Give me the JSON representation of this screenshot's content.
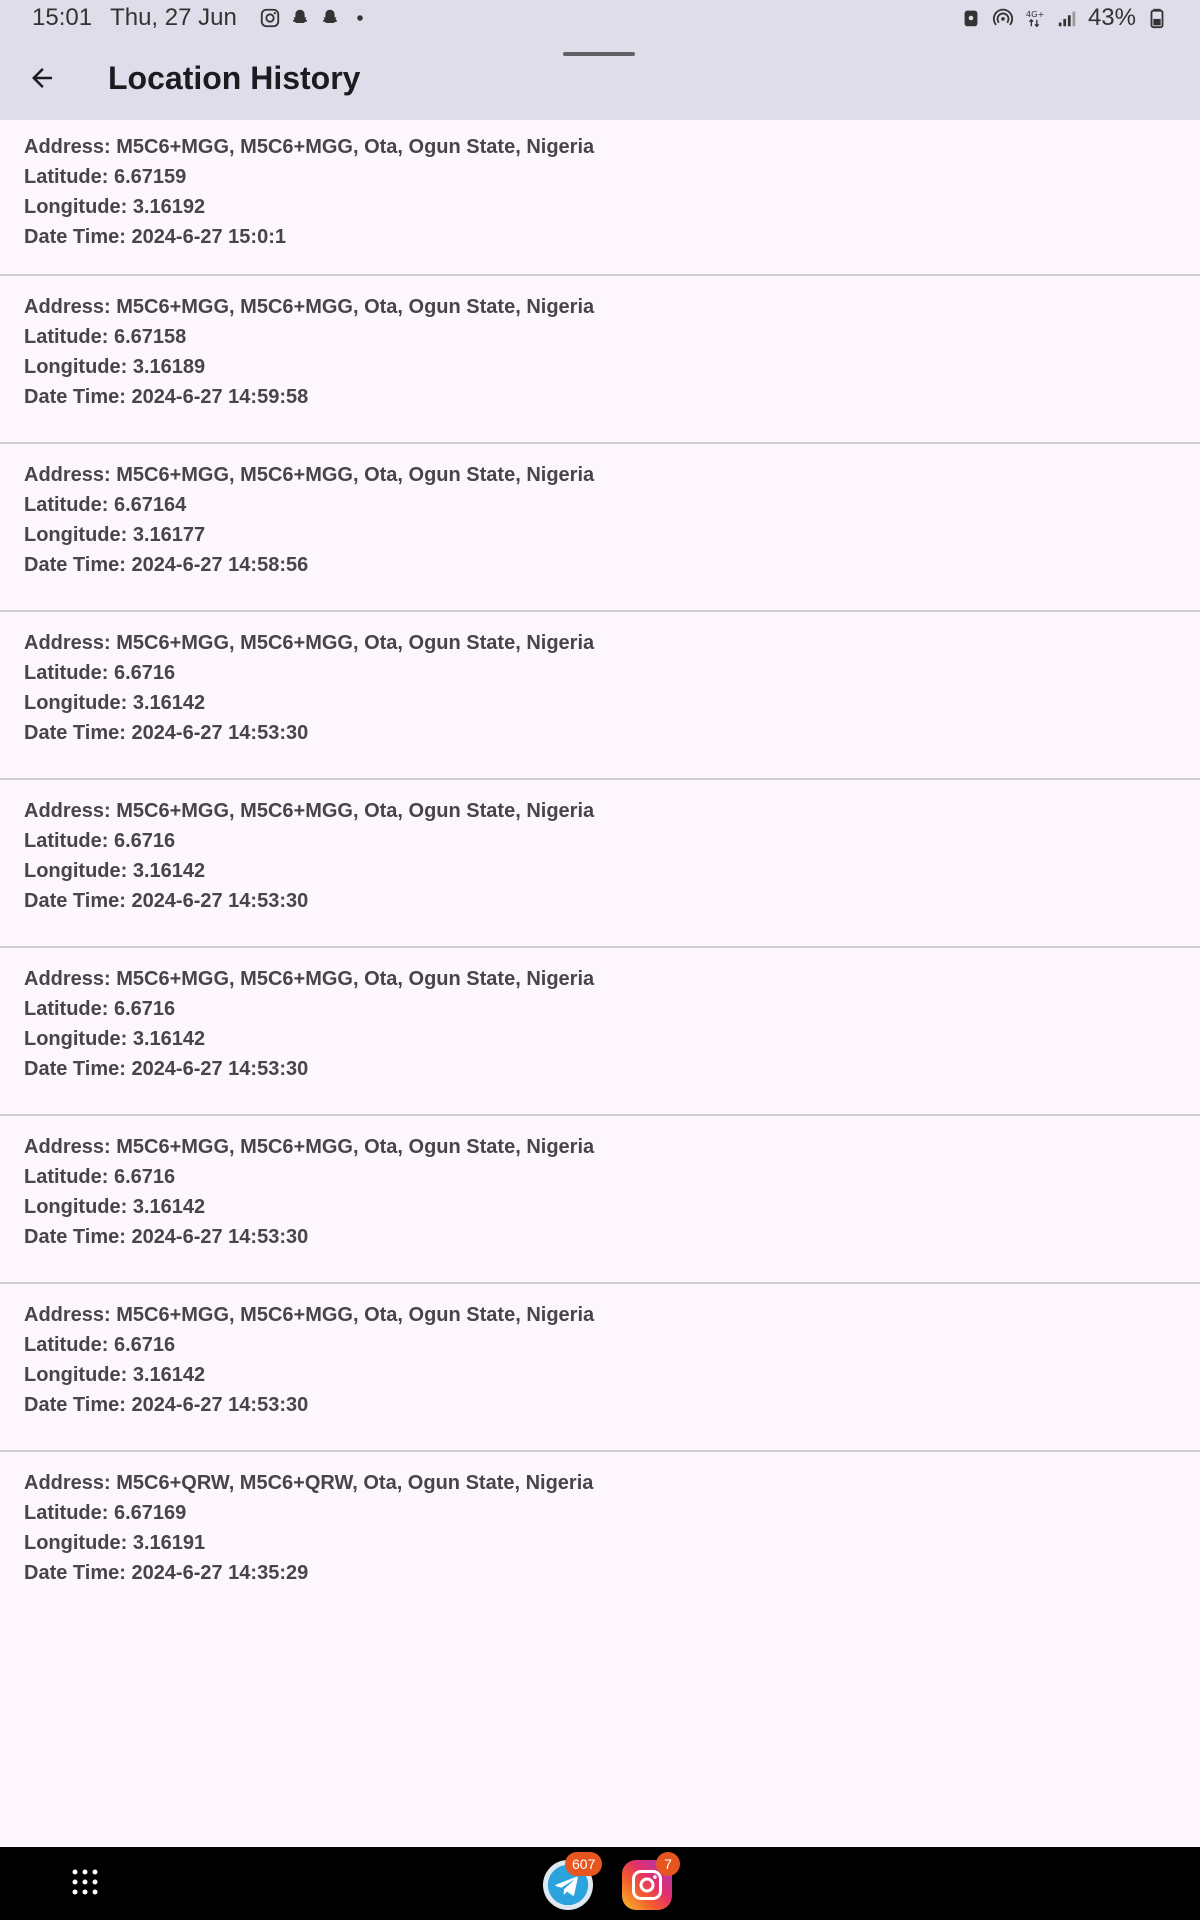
{
  "status_bar": {
    "time": "15:01",
    "date": "Thu, 27 Jun",
    "icons": [
      "instagram-icon",
      "snapchat-icon",
      "snapchat-icon",
      "dot-icon"
    ],
    "battery": "43%",
    "right_icons": [
      "lock-icon",
      "hotspot-icon",
      "network-4g-icon",
      "signal-icon",
      "battery-icon"
    ]
  },
  "app_bar": {
    "title": "Location History",
    "back_icon": "arrow-back-icon"
  },
  "items": [
    {
      "address": "Address: M5C6+MGG, M5C6+MGG, Ota, Ogun State, Nigeria",
      "latitude": "Latitude: 6.67159",
      "longitude": "Longitude: 3.16192",
      "datetime": "Date Time: 2024-6-27 15:0:1"
    },
    {
      "address": "Address: M5C6+MGG, M5C6+MGG, Ota, Ogun State, Nigeria",
      "latitude": "Latitude: 6.67158",
      "longitude": "Longitude: 3.16189",
      "datetime": "Date Time: 2024-6-27 14:59:58"
    },
    {
      "address": "Address: M5C6+MGG, M5C6+MGG, Ota, Ogun State, Nigeria",
      "latitude": "Latitude: 6.67164",
      "longitude": "Longitude: 3.16177",
      "datetime": "Date Time: 2024-6-27 14:58:56"
    },
    {
      "address": "Address: M5C6+MGG, M5C6+MGG, Ota, Ogun State, Nigeria",
      "latitude": "Latitude: 6.6716",
      "longitude": "Longitude: 3.16142",
      "datetime": "Date Time: 2024-6-27 14:53:30"
    },
    {
      "address": "Address: M5C6+MGG, M5C6+MGG, Ota, Ogun State, Nigeria",
      "latitude": "Latitude: 6.6716",
      "longitude": "Longitude: 3.16142",
      "datetime": "Date Time: 2024-6-27 14:53:30"
    },
    {
      "address": "Address: M5C6+MGG, M5C6+MGG, Ota, Ogun State, Nigeria",
      "latitude": "Latitude: 6.6716",
      "longitude": "Longitude: 3.16142",
      "datetime": "Date Time: 2024-6-27 14:53:30"
    },
    {
      "address": "Address: M5C6+MGG, M5C6+MGG, Ota, Ogun State, Nigeria",
      "latitude": "Latitude: 6.6716",
      "longitude": "Longitude: 3.16142",
      "datetime": "Date Time: 2024-6-27 14:53:30"
    },
    {
      "address": "Address: M5C6+MGG, M5C6+MGG, Ota, Ogun State, Nigeria",
      "latitude": "Latitude: 6.6716",
      "longitude": "Longitude: 3.16142",
      "datetime": "Date Time: 2024-6-27 14:53:30"
    },
    {
      "address": "Address: M5C6+QRW, M5C6+QRW, Ota, Ogun State, Nigeria",
      "latitude": "Latitude: 6.67169",
      "longitude": "Longitude: 3.16191",
      "datetime": "Date Time: 2024-6-27 14:35:29"
    }
  ],
  "nav_bar": {
    "apps_icon": "app-grid-icon",
    "telegram_badge": "607",
    "instagram_badge": "7"
  }
}
